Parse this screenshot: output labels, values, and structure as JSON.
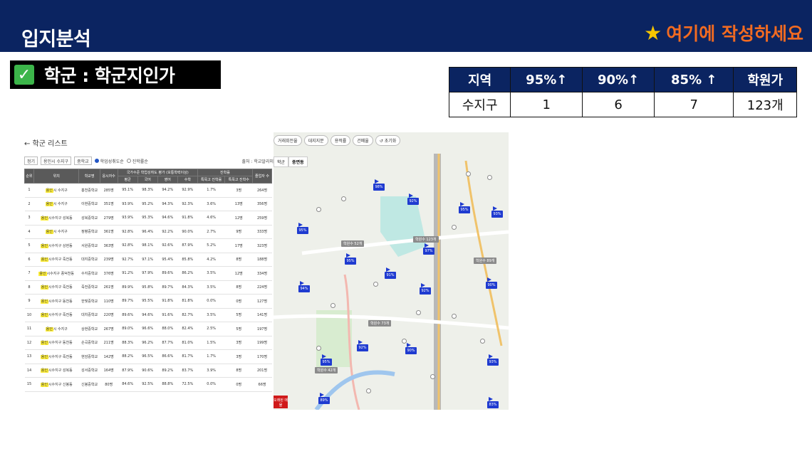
{
  "header": {
    "title": "입지분석",
    "hint_icon": "star-icon",
    "hint": "여기에 작성하세요"
  },
  "section": {
    "check_icon": "check-icon",
    "label": "학군 : 학군지인가"
  },
  "stats": {
    "headers": [
      "지역",
      "95%↑",
      "90%↑",
      "85% ↑",
      "학원가"
    ],
    "row": [
      "수지구",
      "1",
      "6",
      "7",
      "123개"
    ]
  },
  "list": {
    "back_label": "← 학군 리스트",
    "filters": [
      "정기",
      "용인시 수지구",
      "중학교"
    ],
    "radio_on": "학업성취도순",
    "radio_off": "진학률순",
    "source": "출처 : 학교알리미",
    "col_headers": [
      "순위",
      "위치",
      "학교명",
      "응시자수",
      "평균",
      "국어",
      "영어",
      "수학",
      "특목고 진학률",
      "특목고 진학수",
      "졸업자 수"
    ],
    "group_headers": [
      "국가수준 학업성취도 평가 (보통학력이상)",
      "진학률"
    ],
    "rows": [
      [
        "1",
        "용인",
        "시 수지구",
        "홍천중학교",
        "285명",
        "95.1%",
        "98.3%",
        "94.2%",
        "92.9%",
        "1.7%",
        "3명",
        "264명"
      ],
      [
        "2",
        "용인",
        "시 수지구",
        "이현중학교",
        "351명",
        "93.9%",
        "95.2%",
        "94.3%",
        "92.3%",
        "3.6%",
        "13명",
        "356명"
      ],
      [
        "3",
        "용인",
        "시수지구 성복동",
        "성복중학교",
        "279명",
        "93.9%",
        "95.3%",
        "94.6%",
        "91.8%",
        "4.6%",
        "12명",
        "259명"
      ],
      [
        "4",
        "용인",
        "시 수지구",
        "정평중학교",
        "361명",
        "92.8%",
        "96.4%",
        "92.2%",
        "90.0%",
        "2.7%",
        "9명",
        "333명"
      ],
      [
        "5",
        "용인",
        "시수지구 상현동",
        "서원중학교",
        "363명",
        "92.8%",
        "98.1%",
        "92.6%",
        "87.9%",
        "5.2%",
        "17명",
        "323명"
      ],
      [
        "6",
        "용인",
        "시수지구 죽전동",
        "대지중학교",
        "239명",
        "92.7%",
        "97.1%",
        "95.4%",
        "85.8%",
        "4.2%",
        "8명",
        "188명"
      ],
      [
        "7",
        "용인",
        "시수지구 풍덕천동",
        "수지중학교",
        "376명",
        "91.2%",
        "97.9%",
        "89.6%",
        "86.2%",
        "3.5%",
        "12명",
        "334명"
      ],
      [
        "8",
        "용인",
        "시수지구 죽전동",
        "죽전중학교",
        "261명",
        "89.9%",
        "95.8%",
        "89.7%",
        "84.3%",
        "3.5%",
        "8명",
        "224명"
      ],
      [
        "9",
        "용인",
        "시수지구 동천동",
        "한빛중학교",
        "110명",
        "89.7%",
        "95.5%",
        "91.8%",
        "81.8%",
        "0.0%",
        "0명",
        "127명"
      ],
      [
        "10",
        "용인",
        "시수지구 죽전동",
        "대치중학교",
        "220명",
        "89.6%",
        "94.6%",
        "91.6%",
        "82.7%",
        "3.5%",
        "5명",
        "141명"
      ],
      [
        "11",
        "용인",
        "시 수지구",
        "상현중학교",
        "267명",
        "89.0%",
        "96.6%",
        "88.0%",
        "82.4%",
        "2.5%",
        "5명",
        "197명"
      ],
      [
        "12",
        "용인",
        "시수지구 동천동",
        "손곡중학교",
        "211명",
        "88.3%",
        "96.2%",
        "87.7%",
        "81.0%",
        "1.5%",
        "3명",
        "199명"
      ],
      [
        "13",
        "용인",
        "시수지구 죽전동",
        "현암중학교",
        "142명",
        "88.2%",
        "96.5%",
        "86.6%",
        "81.7%",
        "1.7%",
        "3명",
        "170명"
      ],
      [
        "14",
        "용인",
        "시수지구 성복동",
        "성서중학교",
        "164명",
        "87.9%",
        "90.6%",
        "89.2%",
        "83.7%",
        "3.9%",
        "8명",
        "201명"
      ],
      [
        "15",
        "용인",
        "시수지구 신봉동",
        "신봉중학교",
        "80명",
        "84.6%",
        "92.5%",
        "88.8%",
        "72.5%",
        "0.0%",
        "0명",
        "66명"
      ]
    ]
  },
  "map": {
    "tabs": [
      "거래회전율",
      "대지지분",
      "용적률",
      "건폐율",
      "초기화"
    ],
    "modes": [
      "학군",
      "중면동"
    ],
    "pins": [
      "98%",
      "92%",
      "95%",
      "95%",
      "93%",
      "97%",
      "95%",
      "91%",
      "94%",
      "92%",
      "90%",
      "92%",
      "90%",
      "93%",
      "95%",
      "89%",
      "83%"
    ],
    "clusters": [
      "학원수 52개",
      "학원수 123개",
      "학원수 89개",
      "학원수 73개",
      "학원수 42개"
    ],
    "badge": "오래된 매물"
  }
}
